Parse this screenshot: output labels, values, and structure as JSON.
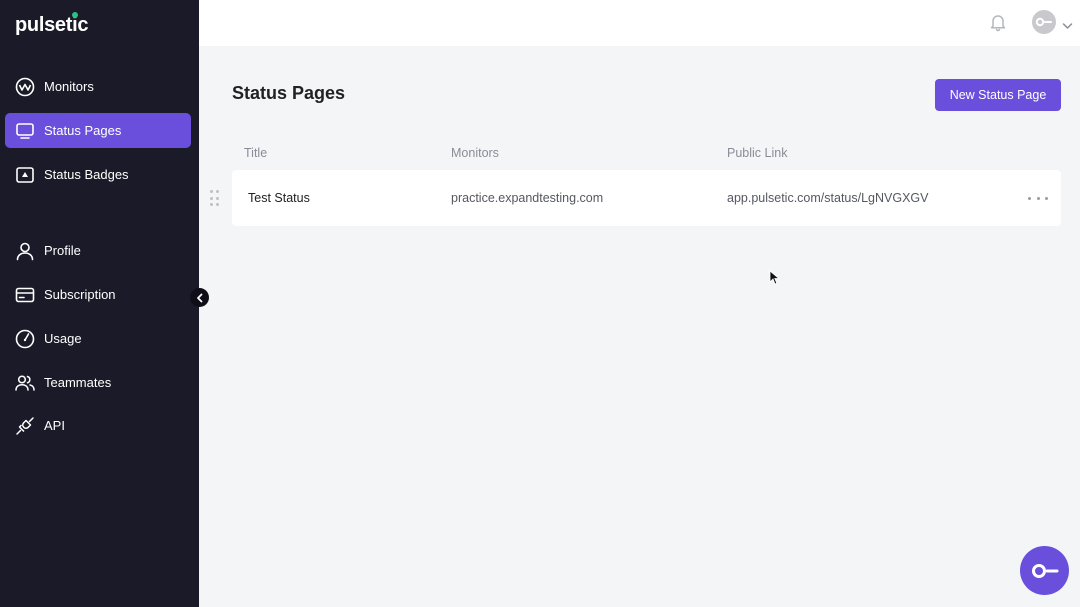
{
  "app": {
    "logo": "pulsetic"
  },
  "sidebar": {
    "items": [
      {
        "label": "Monitors",
        "icon": "pulse-icon"
      },
      {
        "label": "Status Pages",
        "icon": "monitor-icon",
        "active": true
      },
      {
        "label": "Status Badges",
        "icon": "badge-icon"
      },
      {
        "label": "Profile",
        "icon": "user-icon"
      },
      {
        "label": "Subscription",
        "icon": "credit-card-icon"
      },
      {
        "label": "Usage",
        "icon": "gauge-icon"
      },
      {
        "label": "Teammates",
        "icon": "users-icon"
      },
      {
        "label": "API",
        "icon": "plug-icon"
      }
    ]
  },
  "header": {
    "bell": "bell-icon",
    "avatar": "avatar-icon"
  },
  "main": {
    "title": "Status Pages",
    "new_button": "New Status Page",
    "columns": [
      "Title",
      "Monitors",
      "Public Link"
    ],
    "rows": [
      {
        "title": "Test Status",
        "monitors": "practice.expandtesting.com",
        "link": "app.pulsetic.com/status/LgNVGXGV"
      }
    ]
  },
  "colors": {
    "accent": "#6a4fdc",
    "sidebar_bg": "#1b1a29",
    "page_bg": "#f4f5f7"
  }
}
